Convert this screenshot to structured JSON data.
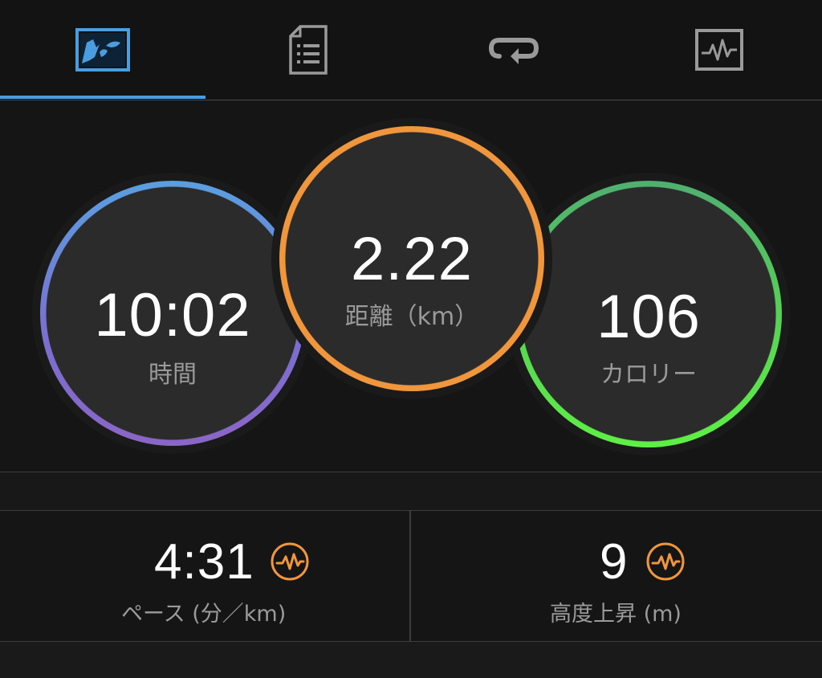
{
  "tabs": [
    {
      "icon": "splash-chart-icon",
      "selected": true
    },
    {
      "icon": "list-document-icon",
      "selected": false
    },
    {
      "icon": "repeat-loop-icon",
      "selected": false
    },
    {
      "icon": "heart-rate-monitor-icon",
      "selected": false
    }
  ],
  "rings": {
    "time": {
      "value": "10:02",
      "label": "時間",
      "color": "#5a9fe0"
    },
    "distance": {
      "value": "2.22",
      "label": "距離（km）",
      "color": "#f0963c"
    },
    "calories": {
      "value": "106",
      "label": "カロリー",
      "color": "#58d356"
    }
  },
  "stats": {
    "pace": {
      "value": "4:31",
      "label": "ペース (分／km)",
      "icon": "heart-rate-wave-icon"
    },
    "elevation": {
      "value": "9",
      "label": "高度上昇 (m)",
      "icon": "heart-rate-wave-icon"
    }
  },
  "colors": {
    "accent_blue": "#4a9ee0",
    "badge_orange": "#f0963c",
    "background": "#151515"
  }
}
